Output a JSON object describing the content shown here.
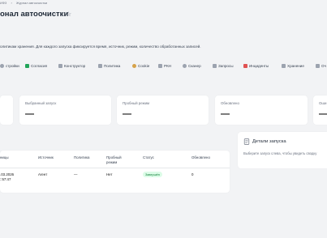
{
  "breadcrumb": {
    "items": [
      "ИФЗ",
      "Журнал автоочистки"
    ]
  },
  "page": {
    "title": "онал автоочистки",
    "description": "олитикам хранения. Для каждого запуска фиксируется время, источник, режим, количество обработанных записей."
  },
  "tabs": [
    {
      "label": "стройки",
      "icon": "settings-icon",
      "color": "#9ca3af"
    },
    {
      "label": "Согласия",
      "icon": "check-square-icon",
      "color": "#22a55a"
    },
    {
      "label": "Конструктор",
      "icon": "edit-icon",
      "color": "#9ca3af"
    },
    {
      "label": "Политика",
      "icon": "document-icon",
      "color": "#9ca3af"
    },
    {
      "label": "Cookie",
      "icon": "cookie-icon",
      "color": "#d6a24a"
    },
    {
      "label": "РКН",
      "icon": "building-icon",
      "color": "#9ca3af"
    },
    {
      "label": "Сканер",
      "icon": "search-icon",
      "color": "#9ca3af"
    },
    {
      "label": "Запросы",
      "icon": "inbox-icon",
      "color": "#9ca3af"
    },
    {
      "label": "Инциденты",
      "icon": "alert-icon",
      "color": "#e05252"
    },
    {
      "label": "Хранение",
      "icon": "archive-icon",
      "color": "#9ca3af"
    },
    {
      "label": "Оч",
      "icon": "broom-icon",
      "color": "#9ca3af"
    }
  ],
  "stats": [
    {
      "label": "",
      "value": ""
    },
    {
      "label": "Выбранный запуск",
      "value": "—"
    },
    {
      "label": "Пробный режим",
      "value": "—"
    },
    {
      "label": "Обновлено",
      "value": "—"
    },
    {
      "label": "Оши",
      "value": "—"
    }
  ],
  "table": {
    "columns": [
      "ницы",
      "Источник",
      "Политика",
      "Пробный режим",
      "Статус",
      "Обновлено"
    ],
    "rows": [
      {
        "time_line1": ".03.2026",
        "time_line2": "::57:47",
        "source": "Агент",
        "policy": "—",
        "dry_run": "Нет",
        "status": "Завершён",
        "updated": "0"
      }
    ]
  },
  "details": {
    "title": "Детали запуска",
    "hint": "Выберите запуск слева, чтобы увидеть сводку"
  },
  "colors": {
    "status_success_bg": "#dcfce7",
    "status_success_text": "#15803d"
  }
}
